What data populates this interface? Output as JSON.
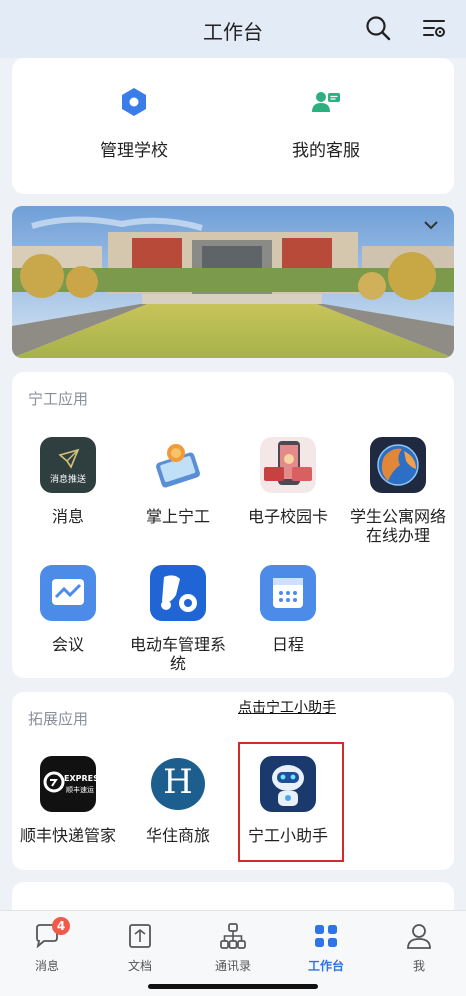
{
  "header": {
    "title": "工作台",
    "search_icon": "search-icon",
    "menu_icon": "settings-list-icon"
  },
  "quick": [
    {
      "label": "管理学校",
      "icon": "hexagon-icon",
      "color": "#3b7de8"
    },
    {
      "label": "我的客服",
      "icon": "customer-service-icon",
      "color": "#2bb07f"
    }
  ],
  "ning_apps": {
    "title": "宁工应用",
    "items": [
      {
        "label": "消息",
        "icon": "message-push-icon",
        "icon_text": "消息推送"
      },
      {
        "label": "掌上宁工",
        "icon": "mobile-app-icon"
      },
      {
        "label": "电子校园卡",
        "icon": "campus-card-icon"
      },
      {
        "label": "学生公寓网络在线办理",
        "icon": "globe-network-icon"
      },
      {
        "label": "会议",
        "icon": "meeting-icon"
      },
      {
        "label": "电动车管理系统",
        "icon": "ebike-settings-icon"
      },
      {
        "label": "日程",
        "icon": "calendar-icon"
      }
    ]
  },
  "ext_apps": {
    "title": "拓展应用",
    "hint": "点击宁工小助手",
    "items": [
      {
        "label": "顺丰快递管家",
        "icon": "sf-express-icon",
        "icon_text_top": "EXPRESS",
        "icon_text_bottom": "顺丰速运"
      },
      {
        "label": "华住商旅",
        "icon": "huazhu-icon",
        "icon_text": "H"
      },
      {
        "label": "宁工小助手",
        "icon": "robot-assistant-icon"
      }
    ]
  },
  "tabbar": {
    "items": [
      {
        "label": "消息",
        "icon": "chat-icon",
        "badge": "4",
        "active": false
      },
      {
        "label": "文档",
        "icon": "document-icon",
        "active": false
      },
      {
        "label": "通讯录",
        "icon": "org-chart-icon",
        "active": false
      },
      {
        "label": "工作台",
        "icon": "workbench-grid-icon",
        "active": true
      },
      {
        "label": "我",
        "icon": "person-icon",
        "active": false
      }
    ]
  },
  "colors": {
    "accent": "#2e73e8",
    "highlight_border": "#d42a2a",
    "badge": "#f05a4a"
  }
}
